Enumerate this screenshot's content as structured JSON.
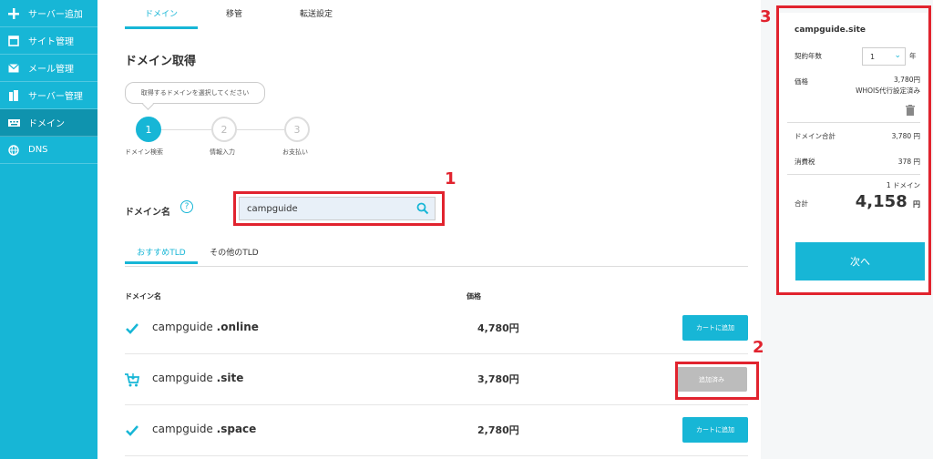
{
  "sidebar": {
    "items": [
      {
        "label": "サーバー追加",
        "icon": "plus-icon"
      },
      {
        "label": "サイト管理",
        "icon": "window-icon"
      },
      {
        "label": "メール管理",
        "icon": "envelope-icon"
      },
      {
        "label": "サーバー管理",
        "icon": "server-icon"
      },
      {
        "label": "ドメイン",
        "icon": "keyboard-icon"
      },
      {
        "label": "DNS",
        "icon": "globe-icon"
      }
    ]
  },
  "main": {
    "tabs": [
      "ドメイン",
      "移管",
      "転送設定"
    ],
    "title": "ドメイン取得",
    "tooltip": "取得するドメインを選択してください",
    "steps": [
      {
        "num": "1",
        "label": "ドメイン検索"
      },
      {
        "num": "2",
        "label": "情報入力"
      },
      {
        "num": "3",
        "label": "お支払い"
      }
    ],
    "domain_label": "ドメイン名",
    "help_icon_text": "?",
    "search_value": "campguide",
    "tld_tabs": [
      "おすすめTLD",
      "その他のTLD"
    ],
    "col_domain": "ドメイン名",
    "col_price": "価格",
    "rows": [
      {
        "name": "campguide",
        "tld": ".online",
        "price": "4,780円",
        "button": "カートに追加",
        "state": "check"
      },
      {
        "name": "campguide",
        "tld": ".site",
        "price": "3,780円",
        "button": "追加済み",
        "state": "cart"
      },
      {
        "name": "campguide",
        "tld": ".space",
        "price": "2,780円",
        "button": "カートに追加",
        "state": "check"
      }
    ]
  },
  "panel": {
    "title": "campguide.site",
    "years_label": "契約年数",
    "years_value": "1",
    "years_unit": "年",
    "price_label": "価格",
    "price_value": "3,780円",
    "whois": "WHOIS代行設定済み",
    "subtotal_label": "ドメイン合計",
    "subtotal_value": "3,780 円",
    "tax_label": "消費税",
    "tax_value": "378 円",
    "count": "1 ドメイン",
    "total_label": "合計",
    "total_value": "4,158",
    "total_unit": "円",
    "next": "次へ"
  },
  "annotations": [
    "1",
    "2",
    "3"
  ],
  "colors": {
    "accent": "#17b6d6",
    "annotation": "#e1232e"
  }
}
